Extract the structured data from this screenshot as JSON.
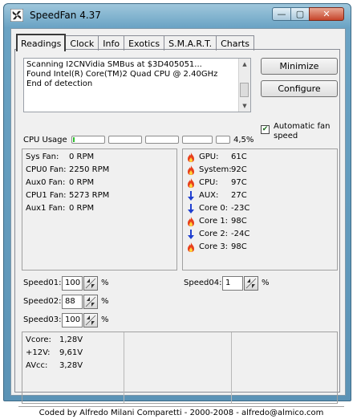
{
  "window": {
    "title": "SpeedFan 4.37",
    "min_glyph": "—",
    "max_glyph": "▢",
    "close_glyph": "✕"
  },
  "tabs": [
    {
      "label": "Readings"
    },
    {
      "label": "Clock"
    },
    {
      "label": "Info"
    },
    {
      "label": "Exotics"
    },
    {
      "label": "S.M.A.R.T."
    },
    {
      "label": "Charts"
    }
  ],
  "log": [
    "Scanning I2CNVidia SMBus at $3D405051...",
    "Found Intel(R) Core(TM)2 Quad CPU @ 2.40GHz",
    "End of detection"
  ],
  "buttons": {
    "minimize": "Minimize",
    "configure": "Configure"
  },
  "auto_fan": {
    "label": "Automatic fan speed",
    "checked": true
  },
  "cpu_usage": {
    "label": "CPU Usage",
    "value_text": "4,5%",
    "cores": [
      0.045,
      0,
      0,
      0,
      0
    ]
  },
  "fans": [
    {
      "label": "Sys Fan:",
      "value": "0 RPM"
    },
    {
      "label": "CPU0 Fan:",
      "value": "2250 RPM"
    },
    {
      "label": "Aux0 Fan:",
      "value": "0 RPM"
    },
    {
      "label": "CPU1 Fan:",
      "value": "5273 RPM"
    },
    {
      "label": "Aux1 Fan:",
      "value": "0 RPM"
    }
  ],
  "temps": [
    {
      "label": "GPU:",
      "value": "61C",
      "icon": "flame-icon"
    },
    {
      "label": "System:",
      "value": "92C",
      "icon": "flame-icon"
    },
    {
      "label": "CPU:",
      "value": "97C",
      "icon": "flame-icon"
    },
    {
      "label": "AUX:",
      "value": "27C",
      "icon": "arrow-down-icon"
    },
    {
      "label": "Core 0:",
      "value": "-23C",
      "icon": "arrow-down-icon"
    },
    {
      "label": "Core 1:",
      "value": "98C",
      "icon": "flame-icon"
    },
    {
      "label": "Core 2:",
      "value": "-24C",
      "icon": "arrow-down-icon"
    },
    {
      "label": "Core 3:",
      "value": "98C",
      "icon": "flame-icon"
    }
  ],
  "speeds": [
    {
      "label": "Speed01:",
      "value": "100",
      "unit": "%"
    },
    {
      "label": "Speed02:",
      "value": "88",
      "unit": "%"
    },
    {
      "label": "Speed03:",
      "value": "100",
      "unit": "%"
    },
    {
      "label": "Speed04:",
      "value": "1",
      "unit": "%"
    }
  ],
  "voltages": [
    {
      "label": "Vcore:",
      "value": "1,28V"
    },
    {
      "label": "+12V:",
      "value": "9,61V"
    },
    {
      "label": "AVcc:",
      "value": "3,28V"
    }
  ],
  "footer": "Coded by Alfredo Milani Comparetti - 2000-2008 - alfredo@almico.com",
  "colors": {
    "flame": "#e8401c",
    "flame_inner": "#ffd23a",
    "arrow": "#1f3fd0",
    "usage": "#2fbf2f"
  }
}
